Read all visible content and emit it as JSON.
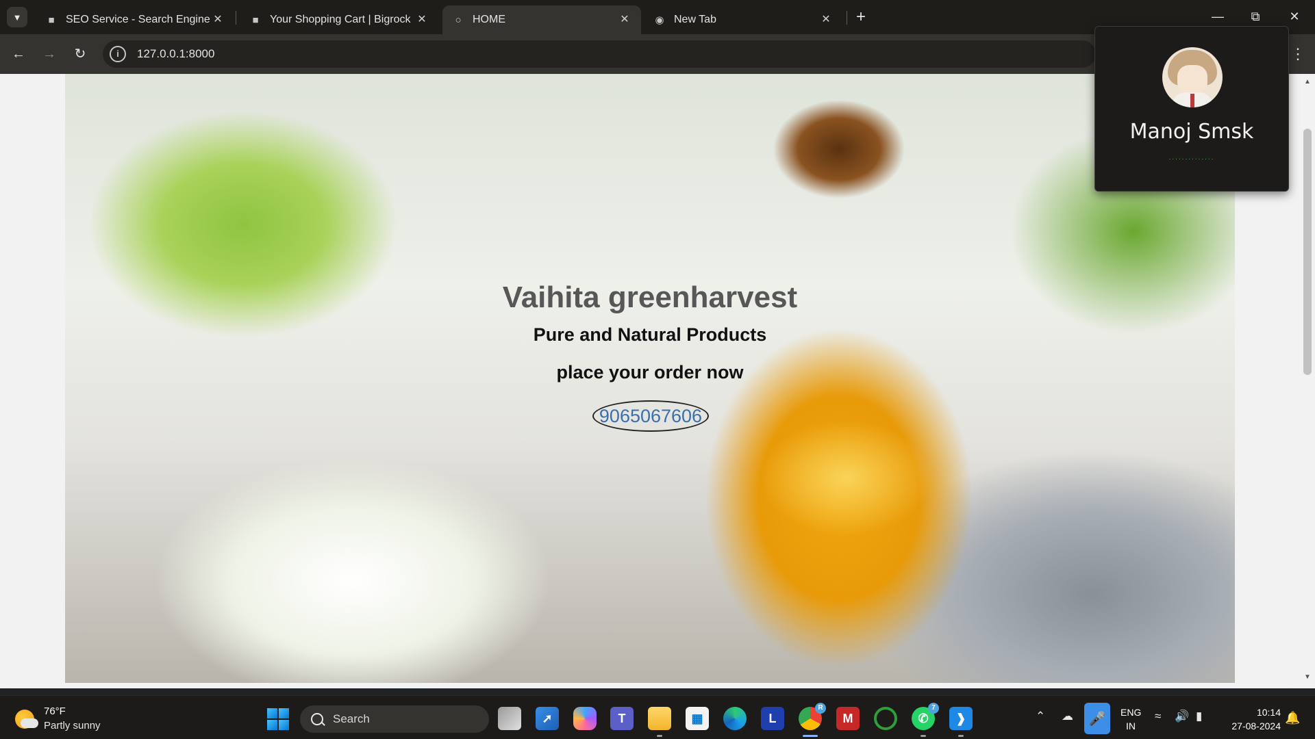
{
  "browser": {
    "tabs": [
      {
        "title": "SEO Service - Search Engine Op",
        "favicon": "bigrock-icon",
        "active": false
      },
      {
        "title": "Your Shopping Cart | Bigrock",
        "favicon": "bigrock-icon",
        "active": false
      },
      {
        "title": "HOME",
        "favicon": "globe-icon",
        "active": true
      },
      {
        "title": "New Tab",
        "favicon": "chrome-icon",
        "active": false
      }
    ],
    "url": "127.0.0.1:8000"
  },
  "page": {
    "brand": "Vaihita greenharvest",
    "tagline": "Pure and Natural Products",
    "cta": "place your order now",
    "phone": "9065067606"
  },
  "profile": {
    "name": "Manoj Smsk",
    "status_dots": "..............",
    "accent": "#4caf50"
  },
  "taskbar": {
    "weather_temp": "76°F",
    "weather_desc": "Partly sunny",
    "search_label": "Search",
    "whatsapp_badge": "7",
    "chrome_badge": "R",
    "lang_line1": "ENG",
    "lang_line2": "IN",
    "time": "10:14",
    "date": "27-08-2024"
  },
  "colors": {
    "brand_text": "#575757",
    "phone_link": "#3a6fae",
    "mic_button": "#3d8ee6"
  }
}
